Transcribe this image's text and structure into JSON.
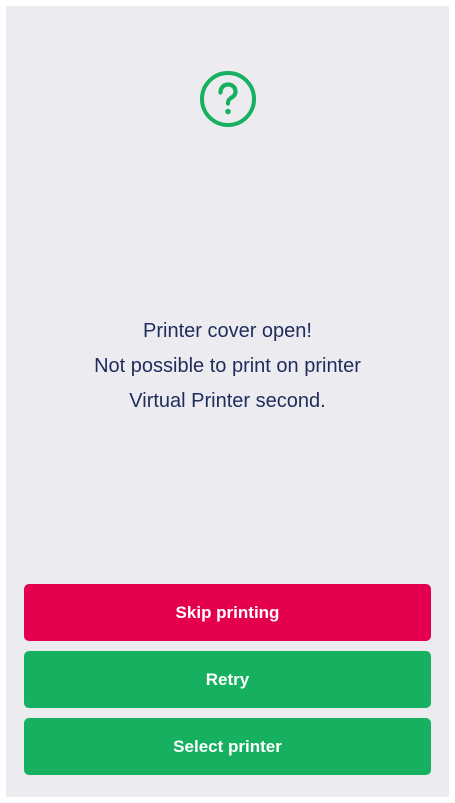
{
  "status_icon": "question-circle-icon",
  "colors": {
    "accent_green": "#16b061",
    "danger_red": "#e5004f",
    "text_navy": "#1f2c5c",
    "background": "#ebebf0"
  },
  "message": {
    "line1": "Printer cover open!",
    "line2": "Not possible to print on printer",
    "line3": "Virtual Printer second."
  },
  "actions": {
    "skip_label": "Skip printing",
    "retry_label": "Retry",
    "select_label": "Select printer"
  }
}
